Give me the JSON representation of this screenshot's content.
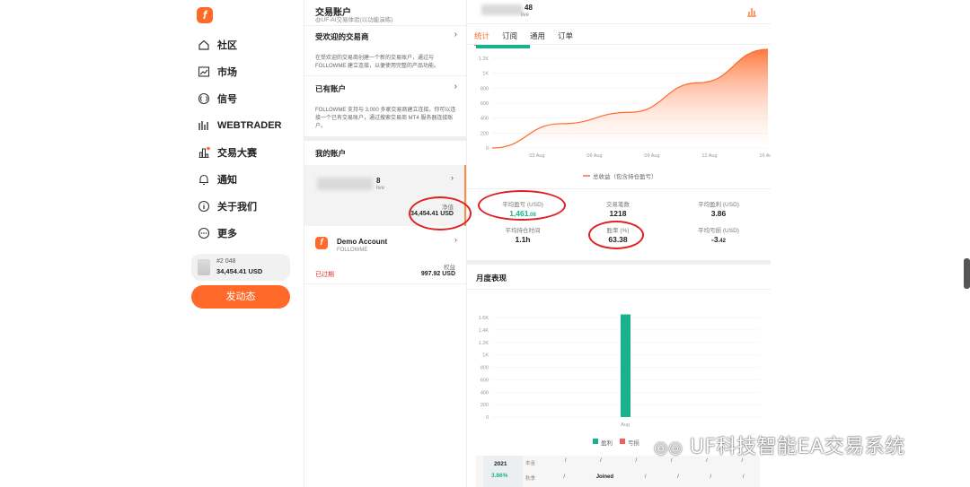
{
  "nav": {
    "logo": "f",
    "items": [
      {
        "label": "社区",
        "icon": "home-icon"
      },
      {
        "label": "市场",
        "icon": "chart-icon"
      },
      {
        "label": "信号",
        "icon": "signal-icon"
      },
      {
        "label": "WEBTRADER",
        "icon": "webtrader-icon"
      },
      {
        "label": "交易大赛",
        "icon": "contest-icon"
      },
      {
        "label": "通知",
        "icon": "bell-icon"
      },
      {
        "label": "关于我们",
        "icon": "info-icon"
      },
      {
        "label": "更多",
        "icon": "more-icon"
      }
    ],
    "account_card": {
      "id": "#2 048",
      "balance": "34,454.41 USD"
    },
    "post_button": "发动态"
  },
  "panel": {
    "title": "交易账户",
    "subtitle": "@UF-AI交易体验(以功能演练)",
    "popular_brokers": {
      "heading": "受欢迎的交易商",
      "text": "在受欢迎的交易商创建一个新的交易账户，通过与 FOLLOWME 建立连接，以便使用完整的产品功能。"
    },
    "existing_account": {
      "heading": "已有账户",
      "text": "FOLLOWME 支持与 3,000 多家交易商建立连接。你可以连接一个已有交易账户，通过搜索交易商 MT4 服务器连接账户。"
    },
    "my_accounts": "我的账户",
    "account1": {
      "id_suffix": "8",
      "sub": "live",
      "net_label": "净值",
      "net_value": "34,454.41 USD"
    },
    "account2": {
      "name": "Demo Account",
      "broker": "FOLLOWME",
      "status": "已过期",
      "equity_label": "权益",
      "equity_value": "997.92 USD"
    }
  },
  "detail": {
    "header": {
      "id_suffix": "48",
      "sub": "live"
    },
    "tabs": [
      "统计",
      "订阅",
      "通用",
      "订单"
    ],
    "active_tab": 0,
    "legend": "总收益（包含持仓盈亏）",
    "stats": [
      {
        "label": "平均盈亏 (USD)",
        "value": "1,461",
        "decimals": ".08",
        "highlight": true
      },
      {
        "label": "交易笔数",
        "value": "1218",
        "decimals": ""
      },
      {
        "label": "平均盈利 (USD)",
        "value": "3.86",
        "decimals": ""
      },
      {
        "label": "平均持仓时间",
        "value": "1.1h",
        "decimals": ""
      },
      {
        "label": "胜率 (%)",
        "value": "63.38",
        "decimals": ""
      },
      {
        "label": "平均亏损 (USD)",
        "value": "-3",
        "decimals": ".42"
      }
    ],
    "monthly_title": "月度表现",
    "monthly_legend": [
      "盈利",
      "亏损"
    ],
    "year_row": {
      "year": "2021",
      "pct": "3.86%",
      "row1_label": "本金",
      "row2_label": "秋季",
      "joined": "Joined",
      "slash": "/"
    },
    "colors": {
      "accent": "#ff6a2a",
      "profit": "#18b38c",
      "loss": "#f06060"
    }
  },
  "chart_data": [
    {
      "type": "area",
      "x": [
        "03 Aug",
        "06 Aug",
        "09 Aug",
        "12 Aug",
        "16 Aug"
      ],
      "yticks": [
        "1.2K",
        "1K",
        "800",
        "600",
        "400",
        "200",
        "0"
      ],
      "ylim": [
        0,
        1300
      ],
      "series": [
        {
          "name": "总收益（包含持仓盈亏）",
          "values": [
            0,
            320,
            470,
            860,
            1300
          ]
        }
      ]
    },
    {
      "type": "bar",
      "categories": [
        "Aug"
      ],
      "yticks": [
        "1.6K",
        "1.4K",
        "1.2K",
        "1K",
        "800",
        "600",
        "400",
        "200",
        "0"
      ],
      "ylim": [
        0,
        1800
      ],
      "series": [
        {
          "name": "盈利",
          "values": [
            1650
          ]
        }
      ]
    }
  ],
  "watermark": "UF科技智能EA交易系统"
}
